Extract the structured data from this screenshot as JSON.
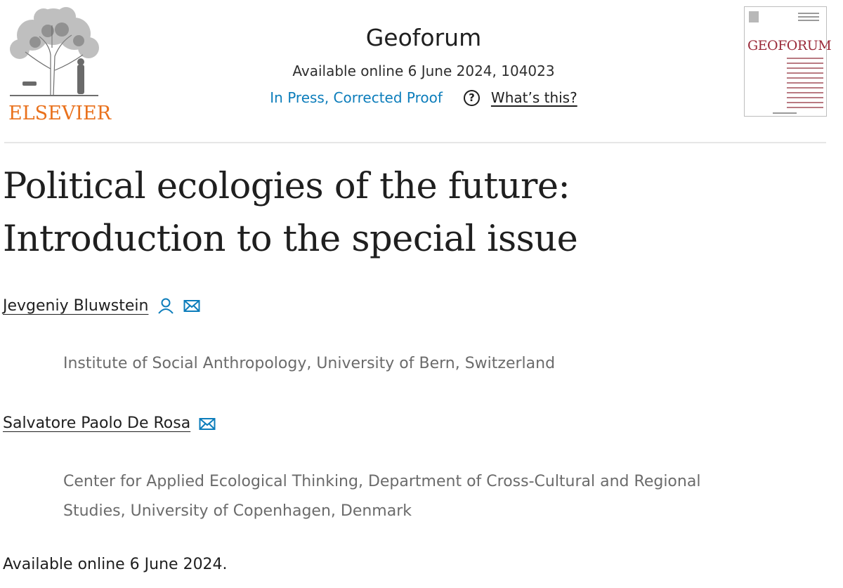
{
  "header": {
    "publisher_wordmark": "ELSEVIER",
    "journal_title": "Geoforum",
    "pub_info": "Available online 6 June 2024, 104023",
    "status_label": "In Press, Corrected Proof",
    "help_label": "What’s this?",
    "cover_title": "GEOFORUM"
  },
  "article": {
    "title_line1": "Political ecologies of the future:",
    "title_line2": "Introduction to the special issue",
    "authors": [
      {
        "name": "Jevgeniy Bluwstein",
        "affiliation": "Institute of Social Anthropology, University of Bern, Switzerland"
      },
      {
        "name": "Salvatore Paolo De Rosa",
        "affiliation_line1": "Center for Applied Ecological Thinking, Department of Cross-Cultural and Regional",
        "affiliation_line2": "Studies, University of Copenhagen, Denmark"
      }
    ],
    "available_online": "Available online 6 June 2024."
  },
  "colors": {
    "link_blue": "#0c7dbb",
    "elsevier_orange": "#e9711c",
    "cover_title": "#9b2b3b",
    "affiliation_gray": "#6b6b6b"
  },
  "icons": [
    "elsevier-tree-logo",
    "help-circle-icon",
    "person-icon",
    "envelope-icon"
  ]
}
